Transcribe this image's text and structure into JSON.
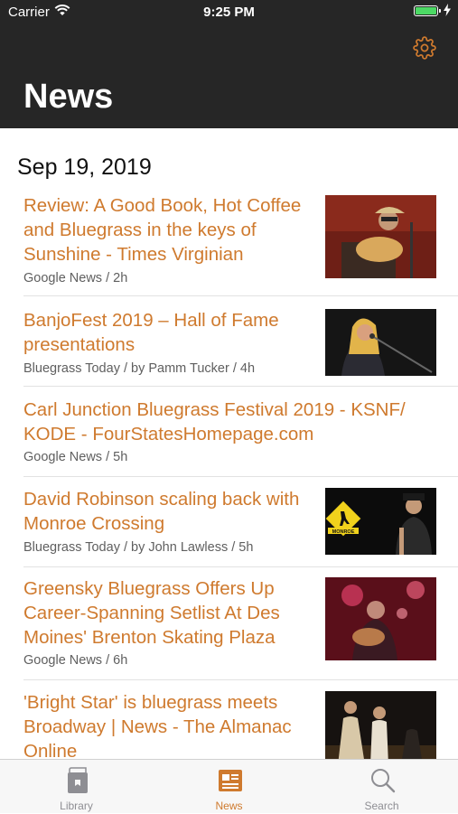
{
  "status_bar": {
    "carrier": "Carrier",
    "time": "9:25 PM",
    "battery_color": "#4cd964"
  },
  "header": {
    "title": "News",
    "settings_icon": "gear-icon",
    "accent": "#cf7a2e"
  },
  "section": {
    "date": "Sep 19, 2019"
  },
  "articles": [
    {
      "headline": "Review: A Good Book, Hot Coffee and Bluegrass in the keys of Sunshine - Times Virginian",
      "source": "Google News / 2h"
    },
    {
      "headline": "BanjoFest 2019 – Hall of Fame presentations",
      "source": "Bluegrass Today / by Pamm Tucker / 4h"
    },
    {
      "headline": "Carl Junction Bluegrass Festival 2019 - KSNF/ KODE - FourStatesHomepage.com",
      "source": "Google News / 5h"
    },
    {
      "headline": "David Robinson scaling back with Monroe Crossing",
      "source": "Bluegrass Today / by John Lawless / 5h"
    },
    {
      "headline": "Greensky Bluegrass Offers Up Career-Spanning Setlist At Des Moines' Brenton Skating Plaza",
      "source": "Google News / 6h"
    },
    {
      "headline": "'Bright Star' is bluegrass meets Broadway | News - The Almanac Online",
      "source": ""
    }
  ],
  "thumb_signs": {
    "monroe": "MONROE"
  },
  "tabbar": {
    "tabs": [
      {
        "label": "Library",
        "icon": "library-icon"
      },
      {
        "label": "News",
        "icon": "news-icon"
      },
      {
        "label": "Search",
        "icon": "search-icon"
      }
    ],
    "active": "News"
  }
}
